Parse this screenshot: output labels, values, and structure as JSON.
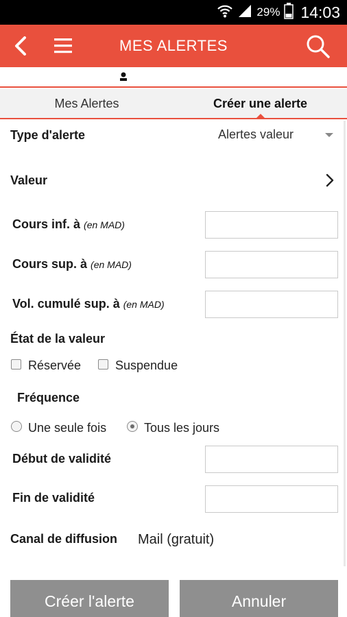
{
  "status_bar": {
    "battery": "29%",
    "time": "14:03",
    "icons": [
      "wifi-icon",
      "signal-icon",
      "battery-icon"
    ]
  },
  "app_bar": {
    "title": "MES ALERTES",
    "icons": [
      "back-icon",
      "menu-icon",
      "search-icon"
    ],
    "color": "#e9503d"
  },
  "user_bar": {
    "icon": "user-icon"
  },
  "tabs": [
    {
      "label": "Mes Alertes",
      "active": false
    },
    {
      "label": "Créer une alerte",
      "active": true
    }
  ],
  "form": {
    "type_label": "Type d'alerte",
    "type_value": "Alertes valeur",
    "valeur_label": "Valeur",
    "cours_inf_label": "Cours inf. à",
    "cours_sup_label": "Cours sup. à",
    "vol_label": "Vol. cumulé sup. à",
    "unit": "(en MAD)",
    "cours_inf_value": "",
    "cours_sup_value": "",
    "vol_value": "",
    "etat_label": "État de la valeur",
    "etat_options": [
      {
        "label": "Réservée",
        "checked": false
      },
      {
        "label": "Suspendue",
        "checked": false
      }
    ],
    "frequence_label": "Fréquence",
    "frequence_options": [
      {
        "label": "Une seule fois",
        "selected": false
      },
      {
        "label": "Tous les jours",
        "selected": true
      }
    ],
    "debut_label": "Début de validité",
    "debut_value": "",
    "fin_label": "Fin de validité",
    "fin_value": "",
    "canal_label": "Canal de diffusion",
    "canal_value": "Mail (gratuit)"
  },
  "buttons": {
    "create": "Créer l'alerte",
    "cancel": "Annuler"
  }
}
